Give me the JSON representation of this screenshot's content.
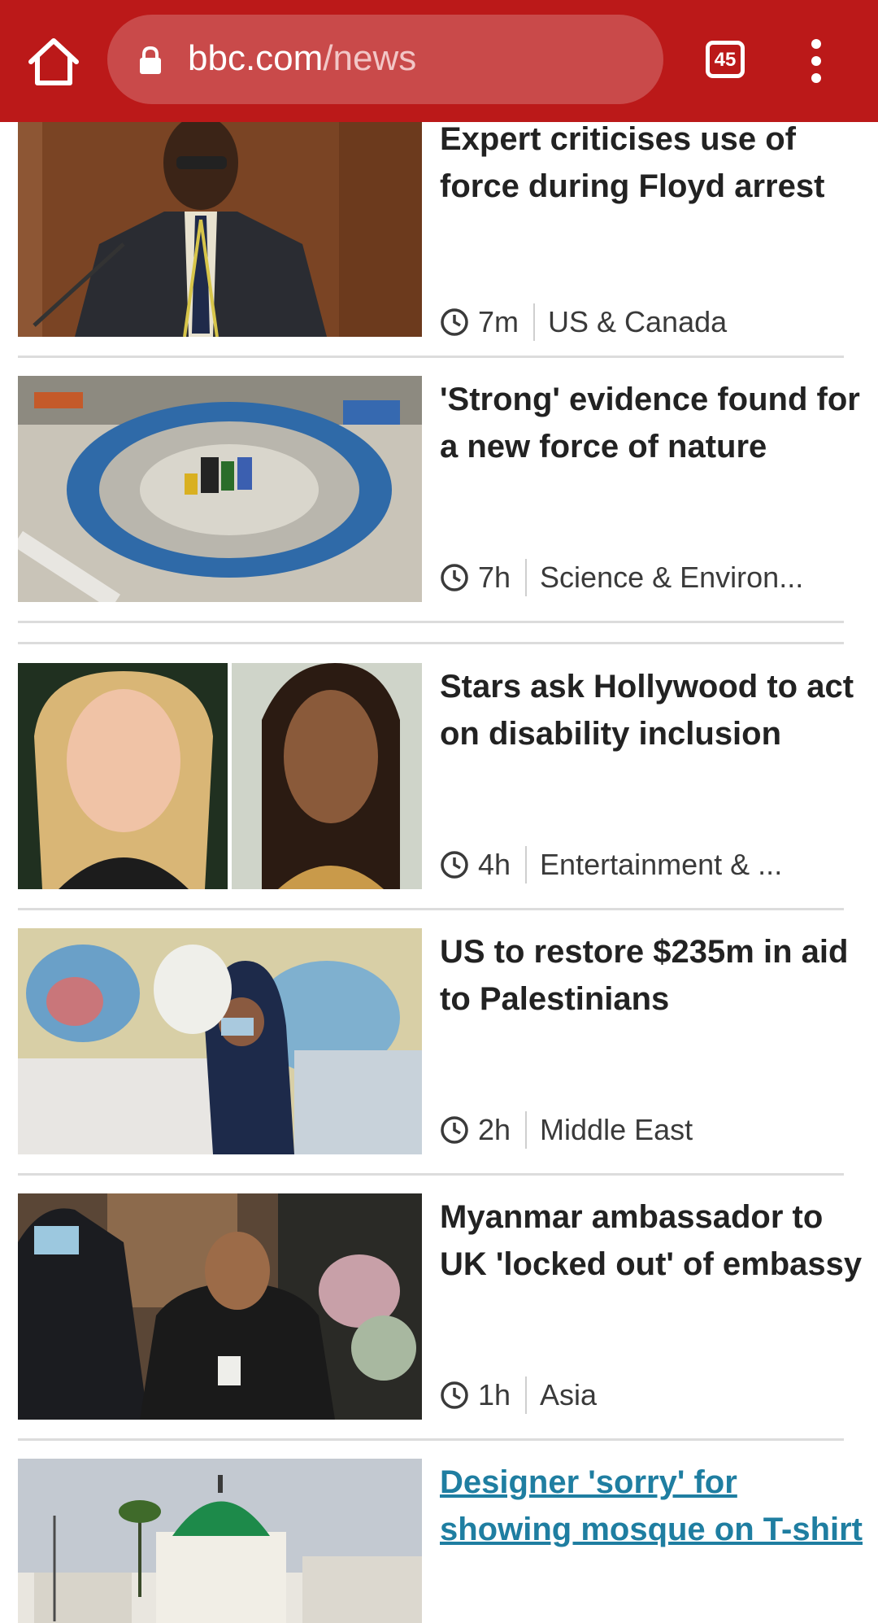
{
  "browser": {
    "url_domain": "bbc.com",
    "url_path": "/news",
    "tab_count": "45",
    "toolbar_color": "#bb1919",
    "icons": [
      "home-icon",
      "lock-icon",
      "tab-switcher-icon",
      "more-vert-icon"
    ]
  },
  "stories": [
    {
      "headline": "Expert criticises use of force during Floyd arrest",
      "age": "7m",
      "section": "US & Canada"
    },
    {
      "headline": "'Strong' evidence found for a new force of nature",
      "age": "7h",
      "section": "Science & Environ..."
    },
    {
      "headline": "Stars ask Hollywood to act on disability inclusion",
      "age": "4h",
      "section": "Entertainment & ..."
    },
    {
      "headline": "US to restore $235m in aid to Palestinians",
      "age": "2h",
      "section": "Middle East"
    },
    {
      "headline": "Myanmar ambassador to UK 'locked out' of embassy",
      "age": "1h",
      "section": "Asia"
    },
    {
      "headline": "Designer 'sorry' for showing mosque on T-shirt"
    }
  ],
  "colors": {
    "visited_link": "#1f7ea1",
    "divider": "#dcdcdc"
  }
}
